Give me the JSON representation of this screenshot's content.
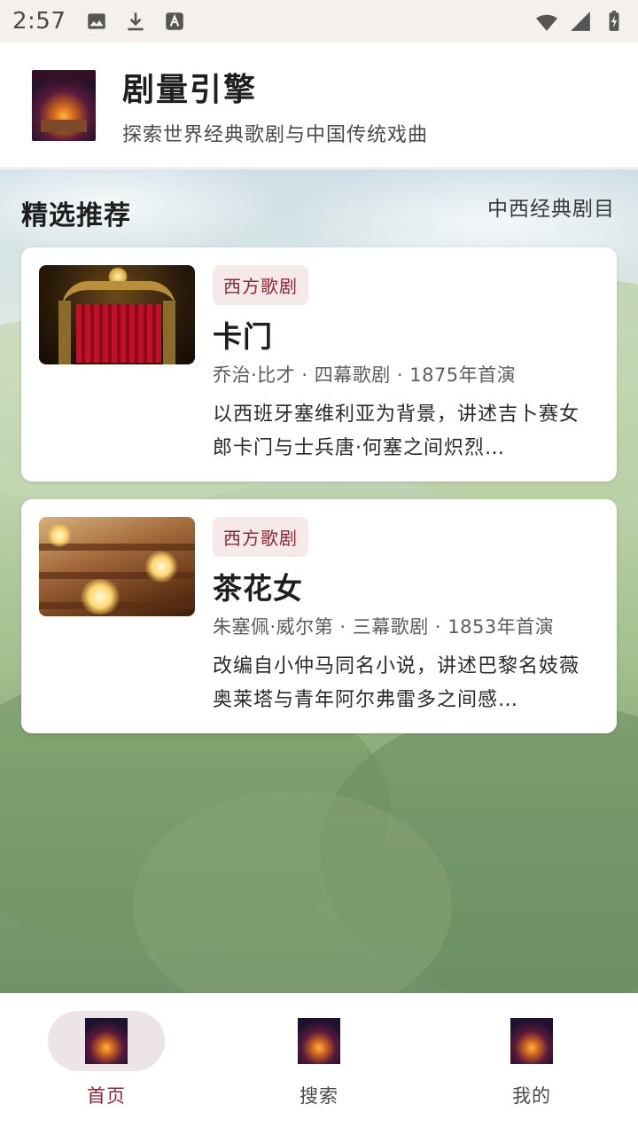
{
  "status_bar": {
    "time": "2:57",
    "left_icons": [
      "image-icon",
      "download-icon",
      "text-a-icon"
    ],
    "right_icons": [
      "wifi-icon",
      "signal-icon",
      "battery-icon"
    ]
  },
  "header": {
    "title": "剧量引擎",
    "subtitle": "探索世界经典歌剧与中国传统戏曲",
    "logo_icon": "opera-stage-logo-icon"
  },
  "section": {
    "title": "精选推荐",
    "subtitle": "中西经典剧目"
  },
  "cards": [
    {
      "tag": "西方歌剧",
      "title": "卡门",
      "meta": "乔治·比才 · 四幕歌剧 · 1875年首演",
      "description": "以西班牙塞维利亚为背景，讲述吉卜赛女郎卡门与士兵唐·何塞之间炽烈…",
      "image": "theater-stage-red-curtain"
    },
    {
      "tag": "西方歌剧",
      "title": "茶花女",
      "meta": "朱塞佩·威尔第 · 三幕歌剧 · 1853年首演",
      "description": "改编自小仲马同名小说，讲述巴黎名妓薇奥莱塔与青年阿尔弗雷多之间感…",
      "image": "opera-house-interior-chandeliers"
    }
  ],
  "bottom_nav": {
    "active_index": 0,
    "items": [
      {
        "label": "首页",
        "icon": "home-icon"
      },
      {
        "label": "搜索",
        "icon": "search-icon"
      },
      {
        "label": "我的",
        "icon": "profile-icon"
      }
    ]
  },
  "colors": {
    "accent": "#8a2a35",
    "tag_bg": "#f6e9ea",
    "active_pill": "#ede4e6"
  }
}
